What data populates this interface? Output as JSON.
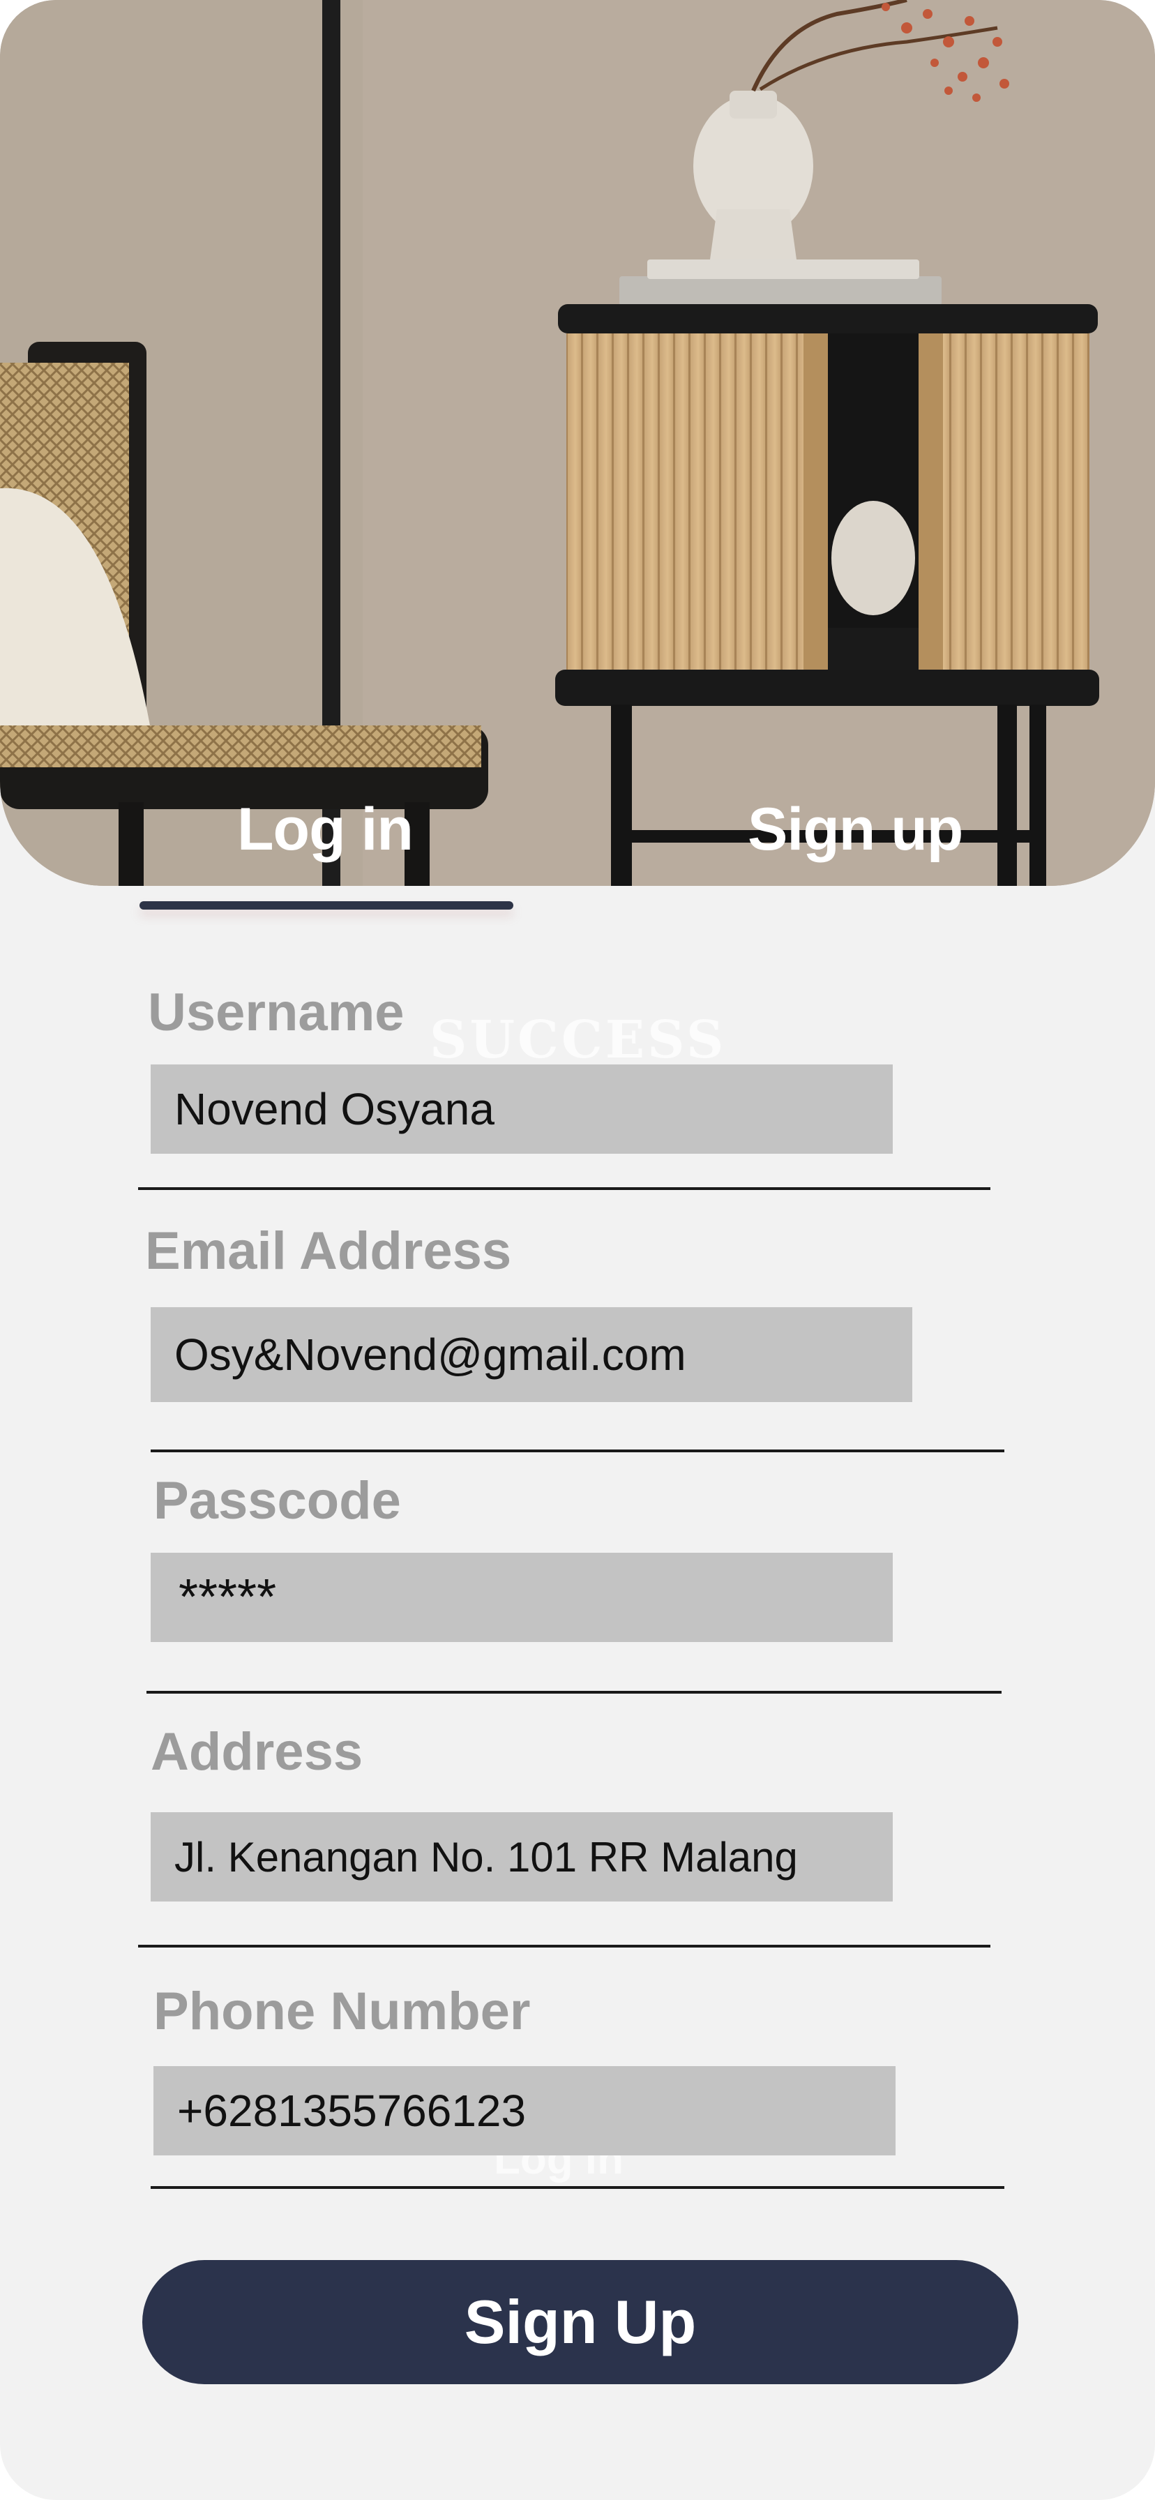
{
  "tabs": {
    "login_label": "Log in",
    "signup_label": "Sign up",
    "active": "login"
  },
  "background_texts": {
    "success": "SUCCESS",
    "login": "Log in"
  },
  "form": {
    "username": {
      "label": "Username",
      "value": "Novend Osyana"
    },
    "email": {
      "label": "Email Address",
      "value": "Osy&Novend@gmail.com"
    },
    "passcode": {
      "label": "Passcode",
      "value": "*****"
    },
    "address": {
      "label": "Address",
      "value": "Jl. Kenangan No. 101 RR Malang"
    },
    "phone": {
      "label": "Phone Number",
      "value": "+6281355766123"
    }
  },
  "submit_label": "Sign Up",
  "colors": {
    "accent": "#2b334c",
    "background": "#f2f2f2",
    "field_fill": "#c3c3c3",
    "label_gray": "#9c9c9c"
  },
  "icons": [
    "furniture-hero-image"
  ]
}
